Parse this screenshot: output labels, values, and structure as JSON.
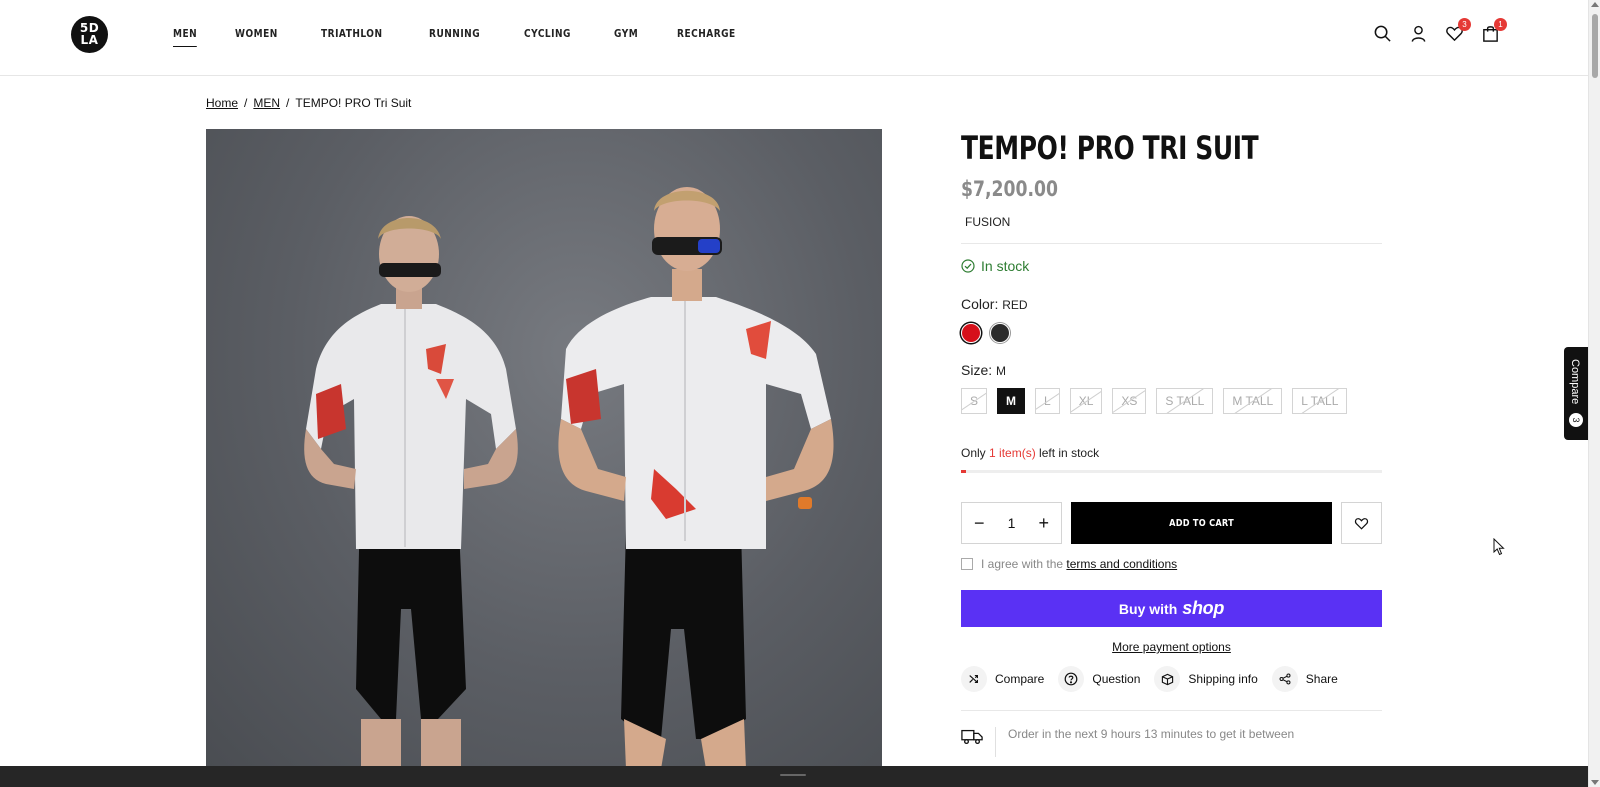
{
  "brand": {
    "logo_line1": "5D",
    "logo_line2": "LA"
  },
  "nav": {
    "items": [
      {
        "label": "MEN",
        "active": true
      },
      {
        "label": "WOMEN"
      },
      {
        "label": "TRIATHLON"
      },
      {
        "label": "RUNNING"
      },
      {
        "label": "CYCLING"
      },
      {
        "label": "GYM"
      },
      {
        "label": "RECHARGE"
      }
    ]
  },
  "header_icons": {
    "search": "search-icon",
    "account": "user-icon",
    "wishlist": "heart-icon",
    "wishlist_count": "3",
    "cart": "bag-icon",
    "cart_count": "1"
  },
  "breadcrumb": {
    "home": "Home",
    "category": "MEN",
    "current": "TEMPO! PRO Tri Suit",
    "sep": "/"
  },
  "product": {
    "title": "TEMPO! PRO TRI SUIT",
    "price": "$7,200.00",
    "vendor": "FUSION",
    "stock_status": "In stock",
    "color_label": "Color:",
    "color_value": "RED",
    "colors": [
      {
        "name": "red",
        "hex": "#d6101a",
        "selected": true
      },
      {
        "name": "black",
        "hex": "#2b2b2b",
        "selected": false
      }
    ],
    "size_label": "Size:",
    "size_value": "M",
    "sizes": [
      {
        "label": "S",
        "state": "disabled"
      },
      {
        "label": "M",
        "state": "selected"
      },
      {
        "label": "L",
        "state": "disabled"
      },
      {
        "label": "XL",
        "state": "disabled"
      },
      {
        "label": "XS",
        "state": "disabled"
      },
      {
        "label": "S TALL",
        "state": "disabled"
      },
      {
        "label": "M TALL",
        "state": "disabled"
      },
      {
        "label": "L TALL",
        "state": "disabled"
      }
    ],
    "scarcity_prefix": "Only",
    "scarcity_count": "1 item(s)",
    "scarcity_suffix": "left in stock",
    "stock_progress": 0.012,
    "quantity": "1",
    "qty_minus": "−",
    "qty_plus": "+",
    "add_to_cart": "ADD TO CART",
    "agree_text": "I agree with the",
    "terms_link": "terms and conditions",
    "buy_with": "Buy with",
    "shop_word": "shop",
    "more_payment": "More payment options",
    "actions": [
      {
        "label": "Compare",
        "icon": "shuffle-icon"
      },
      {
        "label": "Question",
        "icon": "question-icon"
      },
      {
        "label": "Shipping info",
        "icon": "box-icon"
      },
      {
        "label": "Share",
        "icon": "share-icon"
      }
    ],
    "delivery_text": "Order in the next 9 hours 13 minutes to get it between"
  },
  "compare_tab": {
    "label": "Compare",
    "count": "3"
  },
  "colors": {
    "accent_red": "#e53935",
    "stock_green": "#2e7d32",
    "shop_purple": "#5a31f4"
  }
}
